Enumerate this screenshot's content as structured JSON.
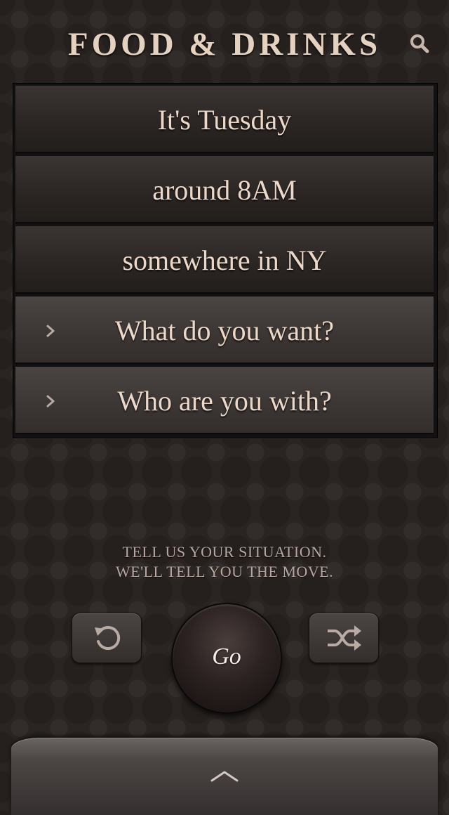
{
  "header": {
    "title": "FOOD & DRINKS",
    "search_icon": "search-icon"
  },
  "situation_rows": [
    {
      "label": "It's Tuesday",
      "has_chevron": false
    },
    {
      "label": "around 8AM",
      "has_chevron": false
    },
    {
      "label": "somewhere in NY",
      "has_chevron": false
    },
    {
      "label": "What do you want?",
      "has_chevron": true
    },
    {
      "label": "Who are you with?",
      "has_chevron": true
    }
  ],
  "tagline": {
    "line1": "TELL US YOUR SITUATION.",
    "line2": "WE'LL TELL YOU THE MOVE."
  },
  "controls": {
    "reset_icon": "refresh-icon",
    "go_label": "Go",
    "shuffle_icon": "shuffle-icon"
  },
  "drawer": {
    "icon": "chevron-up-icon"
  },
  "colors": {
    "background": "#2a2422",
    "text": "#e8d5c6",
    "row_dark": "#2a2523",
    "row_light": "#3c3634"
  }
}
